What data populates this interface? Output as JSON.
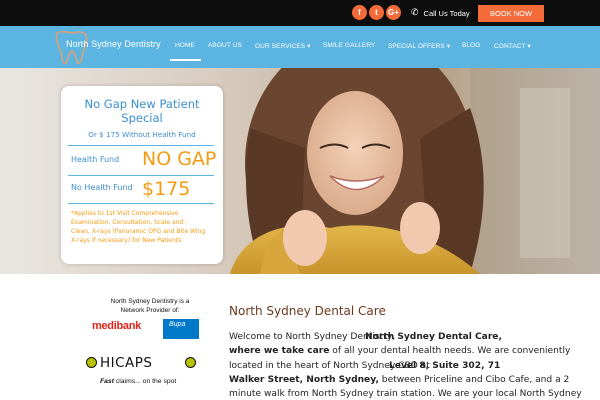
{
  "topbar": {
    "social": [
      {
        "icon": "facebook-icon",
        "glyph": "f"
      },
      {
        "icon": "twitter-icon",
        "glyph": "t"
      },
      {
        "icon": "google-plus-icon",
        "glyph": "G+"
      }
    ],
    "phone_label": "Call Us Today",
    "book_label": "BOOK NOW"
  },
  "nav": {
    "logo_text": "North Sydney Dentistry",
    "items": [
      {
        "label": "HOME",
        "active": true
      },
      {
        "label": "ABOUT US"
      },
      {
        "label": "OUR SERVICES ▾"
      },
      {
        "label": "SMILE GALLERY"
      },
      {
        "label": "SPECIAL OFFERS ▾"
      },
      {
        "label": "BLOG"
      },
      {
        "label": "CONTACT ▾"
      }
    ]
  },
  "promo": {
    "title_line1": "No Gap New Patient",
    "title_line2": "Special",
    "subtitle": "Or $ 175 Without Health Fund",
    "health_fund_label": "Health Fund",
    "health_fund_value": "NO GAP",
    "no_health_fund_label": "No Health Fund",
    "no_health_fund_value": "$175",
    "note_lines": [
      "*Applies to 1st Visit Comprehensive",
      "Examination, Consultation, Scale and -",
      "Clean, X-rays (Panoramic OPG and Bite Wing",
      "X-rays if necessary) for New Patients"
    ]
  },
  "providers": {
    "text_line1": "North Sydney Dentistry is a",
    "text_line2": "Network Provider of:",
    "medibank": "medibank",
    "bupa": "Bupa",
    "hicaps": "HICAPS",
    "hicaps_tag_bold": "Fast",
    "hicaps_tag_rest": " claims... on the spot"
  },
  "content": {
    "title": "North Sydney Dental Care",
    "line1_prefix": "Welcome to North Sydney Dentistry,",
    "line1_overlay": "North Sydney Dental Care,",
    "line2_bold": "where we take care",
    "line2_rest": " of all your dental health needs. We are conveniently",
    "line3_prefix": "located in the heart of North Sydney CBD at",
    "line3_overlay": "Level 8, Suite 302, 71",
    "line4_bold": "Walker Street, North Sydney,",
    "line4_rest": " between Priceline and Cibo Cafe, and a 2",
    "line5": "minute walk from North Sydney train station. We are your local North Sydney"
  },
  "colors": {
    "accent": "#f26b38",
    "nav_blue": "#5cb5e1",
    "promo_blue": "#3d8fd0",
    "promo_orange": "#f39c12"
  }
}
